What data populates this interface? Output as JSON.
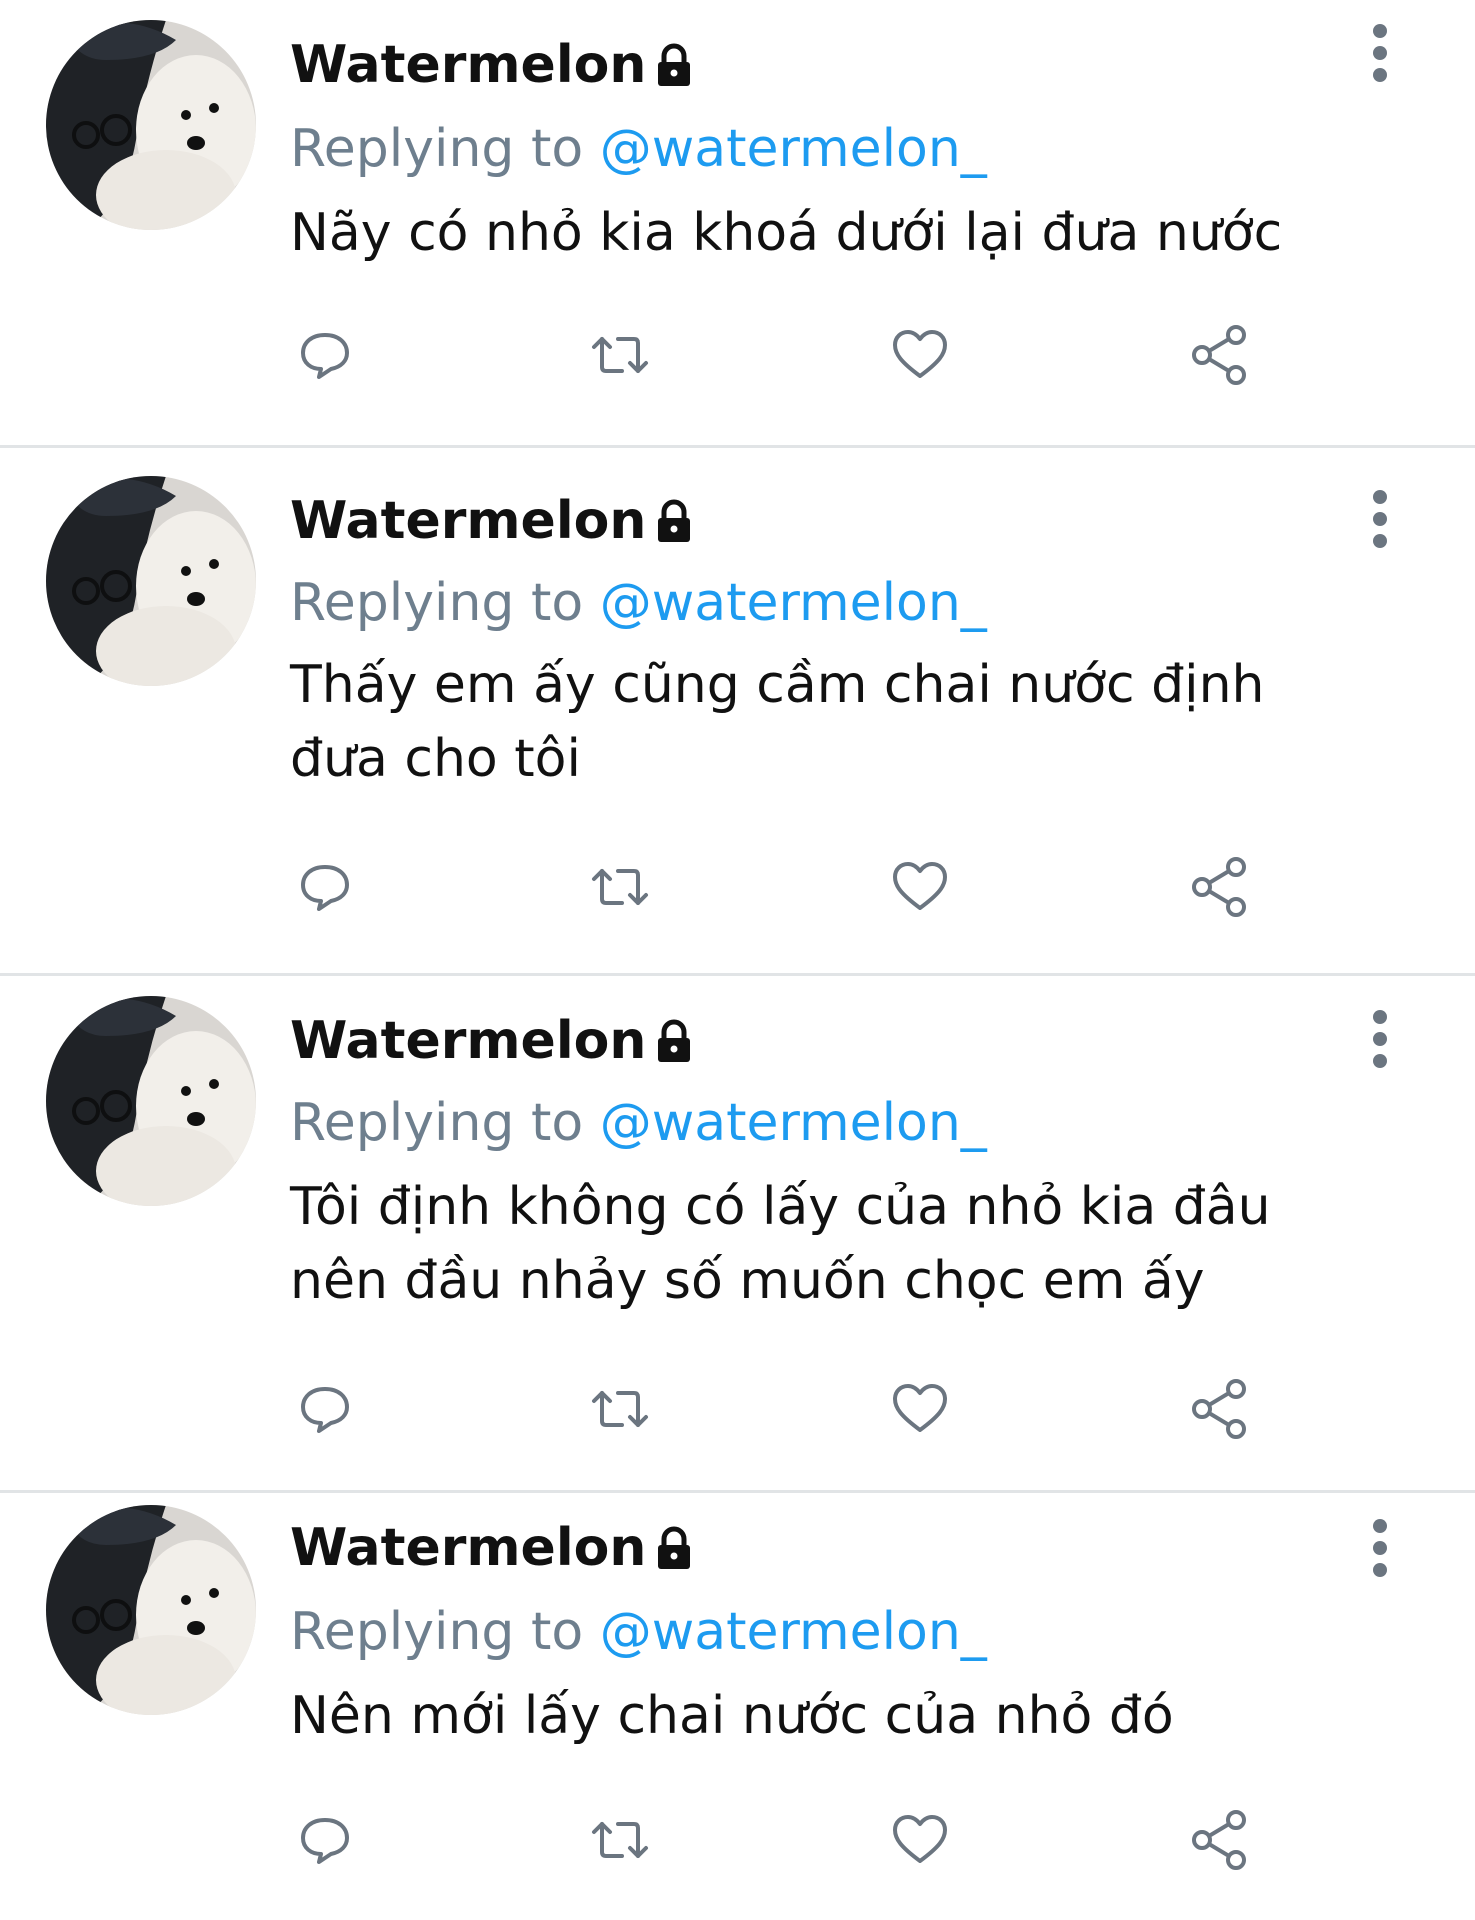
{
  "colors": {
    "handle": "#1d9bf0",
    "muted": "#6e7f8e",
    "icon": "#6b7580",
    "divider": "#e1e4e6"
  },
  "tweets": [
    {
      "author": "Watermelon",
      "reply_prefix": "Replying to",
      "reply_handle": "@watermelon_",
      "text": "Nãy có nhỏ kia khoá dưới lại đưa nước"
    },
    {
      "author": "Watermelon",
      "reply_prefix": "Replying to",
      "reply_handle": "@watermelon_",
      "text": "Thấy em ấy cũng cầm chai nước định đưa cho tôi"
    },
    {
      "author": "Watermelon",
      "reply_prefix": "Replying to",
      "reply_handle": "@watermelon_",
      "text": "Tôi định không có lấy của nhỏ kia đâu nên đầu nhảy số muốn chọc em ấy"
    },
    {
      "author": "Watermelon",
      "reply_prefix": "Replying to",
      "reply_handle": "@watermelon_",
      "text": "Nên mới lấy chai nước của nhỏ đó"
    }
  ],
  "icons": {
    "lock": "lock-icon",
    "more": "more-vertical-icon",
    "reply": "reply-bubble-icon",
    "retweet": "retweet-icon",
    "like": "heart-icon",
    "share": "share-icon"
  }
}
